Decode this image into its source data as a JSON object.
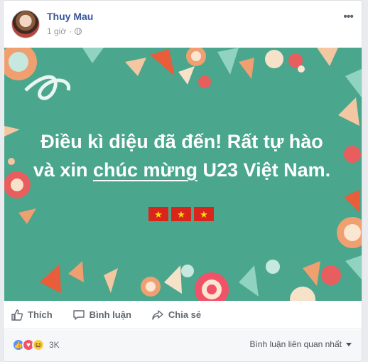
{
  "post": {
    "author": "Thuy Mau",
    "time": "1 giờ",
    "privacy_icon": "globe-icon",
    "more_icon": "more-options-icon",
    "image": {
      "headline_part1": "Điều kì diệu đã đến! Rất tự hào và xin ",
      "headline_underlined": "chúc mừng",
      "headline_part2": " U23 Việt Nam.",
      "flag_star": "★",
      "background_color": "#4aa68d"
    },
    "actions": {
      "like": "Thích",
      "comment": "Bình luận",
      "share": "Chia sẻ"
    },
    "footer": {
      "reaction_count": "3K",
      "reaction_like_glyph": "👍",
      "reaction_love_glyph": "♥",
      "reaction_haha_glyph": "😆",
      "sort_label": "Bình luận liên quan nhất"
    }
  }
}
